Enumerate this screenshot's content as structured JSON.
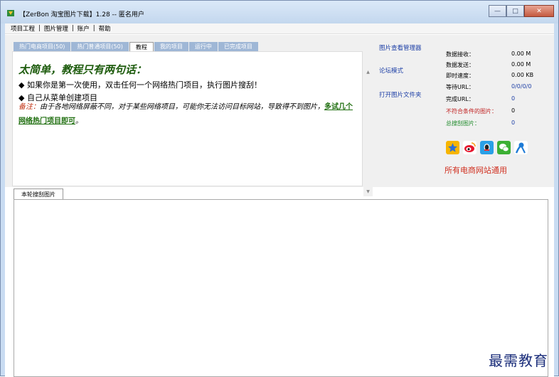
{
  "window": {
    "title": "【ZerBon 淘宝图片下载】1.28 -- 匿名用户",
    "buttons": [
      "minimize",
      "maximize",
      "close"
    ]
  },
  "menu": [
    "项目工程",
    "图片管理",
    "账户",
    "帮助"
  ],
  "tabs": [
    "热门电商项目(50)",
    "热门普通项目(50)",
    "教程",
    "我的项目",
    "运行中",
    "已完成项目"
  ],
  "active_tab": "教程",
  "tutorial": {
    "heading": "太简单，教程只有两句话：",
    "line1": "◆ 如果你是第一次使用，双击任何一个网络热门项目，执行图片搜刮！",
    "line2": "◆ 自己从菜单创建项目",
    "note_label": "备注：",
    "note_text": "由于各地网络屏蔽不同，对于某些网络项目，可能你无法访问目标网站，导致得不到图片，",
    "note_link": "多试几个网络热门项目即可",
    "note_end": "。"
  },
  "links": [
    "图片查看管理器",
    "论坛模式",
    "打开图片文件夹"
  ],
  "stats": [
    {
      "label": "数据接收：",
      "value": "0.00 M",
      "color": "#000000",
      "value_color": "#000000"
    },
    {
      "label": "数据发送：",
      "value": "0.00 M",
      "color": "#000000",
      "value_color": "#000000"
    },
    {
      "label": "即时速度：",
      "value": "0.00 KB",
      "color": "#000000",
      "value_color": "#000000"
    },
    {
      "label": "等待URL：",
      "value": "0/0/0/0",
      "color": "#000000",
      "value_color": "#1d3fa6"
    },
    {
      "label": "完成URL：",
      "value": "0",
      "color": "#000000",
      "value_color": "#1d3fa6"
    },
    {
      "label": "不符合条件的图片：",
      "value": "0",
      "color": "#c02020",
      "value_color": "#000000"
    },
    {
      "label": "总搜刮图片：",
      "value": "0",
      "color": "#1e8a2a",
      "value_color": "#1d3fa6"
    }
  ],
  "social_icons": [
    "qzone-icon",
    "weibo-icon",
    "qq-icon",
    "wechat-icon",
    "tencent-weibo-icon"
  ],
  "tagline": "所有电商网站通用",
  "lower_tab": "本轮搜刮图片",
  "watermark": "最需教育",
  "colors": {
    "accent": "#1d3fa6",
    "tab_bg": "#9fb7d6",
    "heading": "#1e5c0e",
    "tagline": "#d03020"
  }
}
